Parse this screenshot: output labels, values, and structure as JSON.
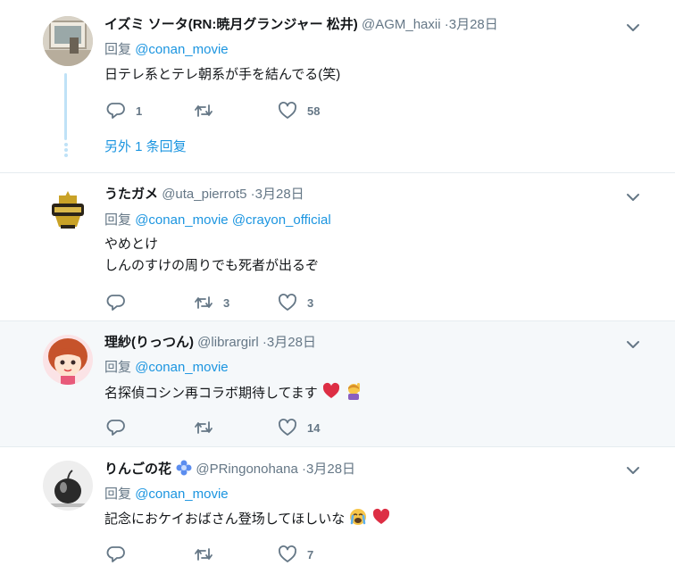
{
  "tweets": [
    {
      "name": "イズミ ソータ(RN:暁月グランジャー 松井)",
      "handle": "@AGM_haxii",
      "date": "·3月28日",
      "reply_prefix": "回复",
      "mentions": [
        "@conan_movie"
      ],
      "lines": [
        "日テレ系とテレ朝系が手を結んでる(笑)"
      ],
      "replies": "1",
      "retweets": "",
      "likes": "58",
      "more_replies": "另外 1 条回复"
    },
    {
      "name": "うたガメ",
      "handle": "@uta_pierrot5",
      "date": "·3月28日",
      "reply_prefix": "回复",
      "mentions": [
        "@conan_movie",
        "@crayon_official"
      ],
      "lines": [
        "やめとけ",
        "しんのすけの周りでも死者が出るぞ"
      ],
      "replies": "",
      "retweets": "3",
      "likes": "3"
    },
    {
      "name": "理紗(りっつん)",
      "handle": "@librargirl",
      "date": "·3月28日",
      "reply_prefix": "回复",
      "mentions": [
        "@conan_movie"
      ],
      "lines": [
        "名探偵コシン再コラボ期待してます"
      ],
      "replies": "",
      "retweets": "",
      "likes": "14"
    },
    {
      "name": "りんごの花",
      "handle": "@PRingonohana",
      "date": "·3月28日",
      "reply_prefix": "回复",
      "mentions": [
        "@conan_movie"
      ],
      "lines": [
        "記念におケイおばさん登场してほしいな"
      ],
      "replies": "",
      "retweets": "",
      "likes": "7"
    }
  ],
  "colors": {
    "link": "#1b95e0",
    "muted": "#657786",
    "text": "#14171a",
    "hover_bg": "#f5f8fa",
    "divider": "#e6ecf0",
    "thread_line": "#bfe2f7"
  },
  "icons": [
    "reply-icon",
    "retweet-icon",
    "like-icon",
    "chevron-down-icon",
    "heart-emoji",
    "person-raising-hand-emoji",
    "crying-face-emoji",
    "flower-emoji"
  ]
}
